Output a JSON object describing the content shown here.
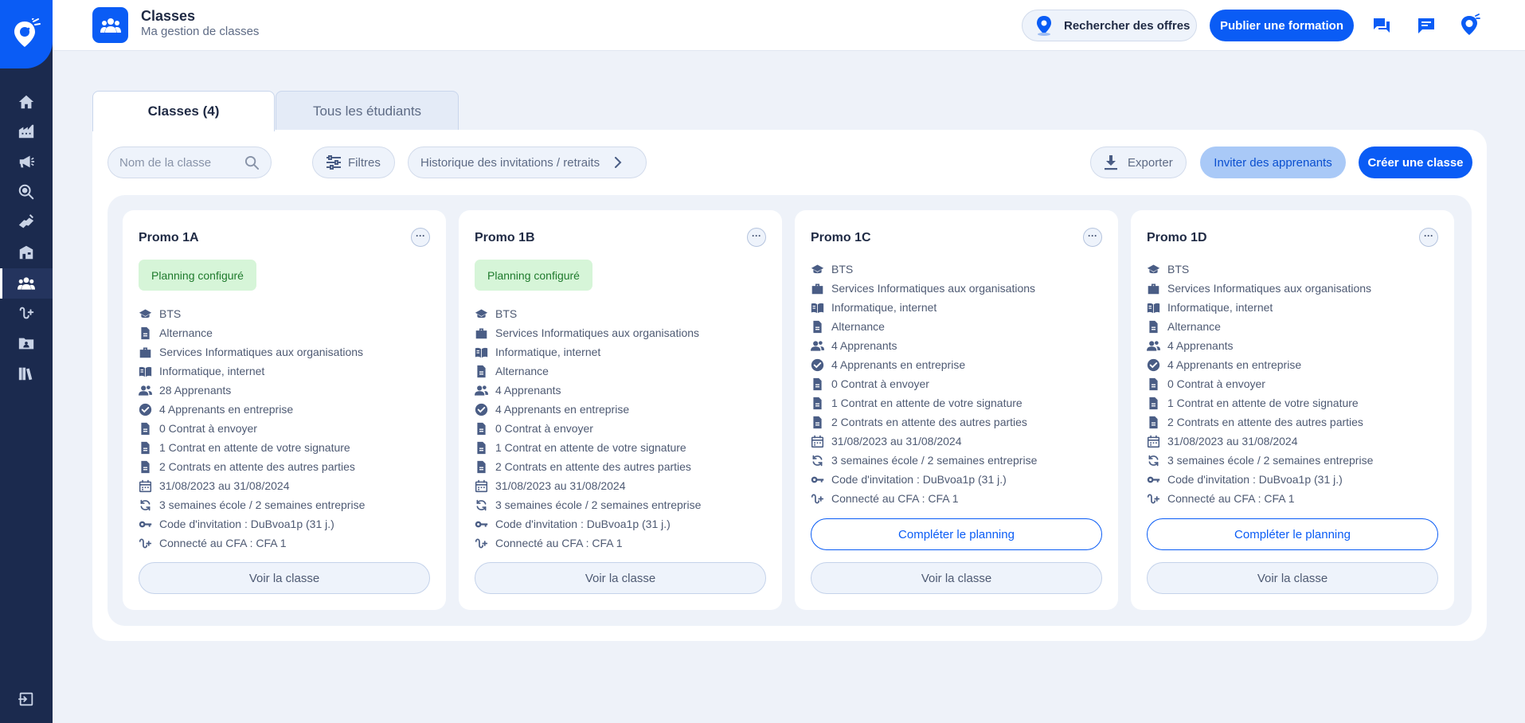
{
  "header": {
    "title": "Classes",
    "subtitle": "Ma gestion de classes",
    "search_offers_label": "Rechercher des offres",
    "publish_label": "Publier une formation"
  },
  "sidebar": {
    "items": [
      {
        "icon": "home-icon"
      },
      {
        "icon": "company-icon"
      },
      {
        "icon": "megaphone-icon"
      },
      {
        "icon": "search-location-icon"
      },
      {
        "icon": "handshake-icon"
      },
      {
        "icon": "school-icon"
      },
      {
        "icon": "classes-icon",
        "active": true
      },
      {
        "icon": "connections-icon"
      },
      {
        "icon": "folder-icon"
      },
      {
        "icon": "library-icon"
      }
    ],
    "logout_icon": "logout-icon"
  },
  "tabs": [
    {
      "label": "Classes (4)",
      "active": true
    },
    {
      "label": "Tous les étudiants",
      "active": false
    }
  ],
  "toolbar": {
    "search_placeholder": "Nom de la classe",
    "filters_label": "Filtres",
    "history_label": "Historique des invitations / retraits",
    "export_label": "Exporter",
    "invite_label": "Inviter des apprenants",
    "create_label": "Créer une classe"
  },
  "cards": [
    {
      "title": "Promo 1A",
      "badge": "Planning configuré",
      "rows": [
        {
          "icon": "graduation-cap-icon",
          "text": "BTS"
        },
        {
          "icon": "document-icon",
          "text": "Alternance"
        },
        {
          "icon": "briefcase-icon",
          "text": "Services Informatiques aux organisations"
        },
        {
          "icon": "book-icon",
          "text": "Informatique, internet"
        },
        {
          "icon": "people-icon",
          "text": "28 Apprenants"
        },
        {
          "icon": "check-circle-icon",
          "text": "4 Apprenants en entreprise"
        },
        {
          "icon": "document-icon",
          "text": "0 Contrat à envoyer"
        },
        {
          "icon": "document-icon",
          "text": "1 Contrat en attente de votre signature"
        },
        {
          "icon": "document-icon",
          "text": "2 Contrats en attente des autres parties"
        },
        {
          "icon": "calendar-icon",
          "text": "31/08/2023 au 31/08/2024"
        },
        {
          "icon": "cycle-icon",
          "text": "3 semaines école / 2 semaines entreprise"
        },
        {
          "icon": "key-icon",
          "text": "Code d'invitation : DuBvoa1p (31 j.)"
        },
        {
          "icon": "link-icon",
          "text": "Connecté au CFA : CFA 1"
        }
      ],
      "complete_label": "",
      "view_label": "Voir la classe"
    },
    {
      "title": "Promo 1B",
      "badge": "Planning configuré",
      "rows": [
        {
          "icon": "graduation-cap-icon",
          "text": "BTS"
        },
        {
          "icon": "briefcase-icon",
          "text": "Services Informatiques aux organisations"
        },
        {
          "icon": "book-icon",
          "text": "Informatique, internet"
        },
        {
          "icon": "document-icon",
          "text": "Alternance"
        },
        {
          "icon": "people-icon",
          "text": "4 Apprenants"
        },
        {
          "icon": "check-circle-icon",
          "text": "4 Apprenants en entreprise"
        },
        {
          "icon": "document-icon",
          "text": "0 Contrat à envoyer"
        },
        {
          "icon": "document-icon",
          "text": "1 Contrat en attente de votre signature"
        },
        {
          "icon": "document-icon",
          "text": "2 Contrats en attente des autres parties"
        },
        {
          "icon": "calendar-icon",
          "text": "31/08/2023 au 31/08/2024"
        },
        {
          "icon": "cycle-icon",
          "text": "3 semaines école / 2 semaines entreprise"
        },
        {
          "icon": "key-icon",
          "text": "Code d'invitation : DuBvoa1p (31 j.)"
        },
        {
          "icon": "link-icon",
          "text": "Connecté au CFA : CFA 1"
        }
      ],
      "complete_label": "",
      "view_label": "Voir la classe"
    },
    {
      "title": "Promo 1C",
      "badge": "",
      "rows": [
        {
          "icon": "graduation-cap-icon",
          "text": "BTS"
        },
        {
          "icon": "briefcase-icon",
          "text": "Services Informatiques aux organisations"
        },
        {
          "icon": "book-icon",
          "text": "Informatique, internet"
        },
        {
          "icon": "document-icon",
          "text": "Alternance"
        },
        {
          "icon": "people-icon",
          "text": "4 Apprenants"
        },
        {
          "icon": "check-circle-icon",
          "text": "4 Apprenants en entreprise"
        },
        {
          "icon": "document-icon",
          "text": "0 Contrat à envoyer"
        },
        {
          "icon": "document-icon",
          "text": "1 Contrat en attente de votre signature"
        },
        {
          "icon": "document-icon",
          "text": "2 Contrats en attente des autres parties"
        },
        {
          "icon": "calendar-icon",
          "text": "31/08/2023 au 31/08/2024"
        },
        {
          "icon": "cycle-icon",
          "text": "3 semaines école / 2 semaines entreprise"
        },
        {
          "icon": "key-icon",
          "text": "Code d'invitation : DuBvoa1p (31 j.)"
        },
        {
          "icon": "link-icon",
          "text": "Connecté au CFA : CFA 1"
        }
      ],
      "complete_label": "Compléter le planning",
      "view_label": "Voir la classe"
    },
    {
      "title": "Promo 1D",
      "badge": "",
      "rows": [
        {
          "icon": "graduation-cap-icon",
          "text": "BTS"
        },
        {
          "icon": "briefcase-icon",
          "text": "Services Informatiques aux organisations"
        },
        {
          "icon": "book-icon",
          "text": "Informatique, internet"
        },
        {
          "icon": "document-icon",
          "text": "Alternance"
        },
        {
          "icon": "people-icon",
          "text": "4 Apprenants"
        },
        {
          "icon": "check-circle-icon",
          "text": "4 Apprenants en entreprise"
        },
        {
          "icon": "document-icon",
          "text": "0 Contrat à envoyer"
        },
        {
          "icon": "document-icon",
          "text": "1 Contrat en attente de votre signature"
        },
        {
          "icon": "document-icon",
          "text": "2 Contrats en attente des autres parties"
        },
        {
          "icon": "calendar-icon",
          "text": "31/08/2023 au 31/08/2024"
        },
        {
          "icon": "cycle-icon",
          "text": "3 semaines école / 2 semaines entreprise"
        },
        {
          "icon": "key-icon",
          "text": "Code d'invitation : DuBvoa1p (31 j.)"
        },
        {
          "icon": "link-icon",
          "text": "Connecté au CFA : CFA 1"
        }
      ],
      "complete_label": "Compléter le planning",
      "view_label": "Voir la classe"
    }
  ],
  "colors": {
    "primary": "#0a5cf5",
    "sidebar": "#1b2a4e",
    "background": "#eef2f9",
    "badge_bg": "#d6f5d8",
    "badge_text": "#1e7a2c",
    "icon": "#4a5d85"
  }
}
